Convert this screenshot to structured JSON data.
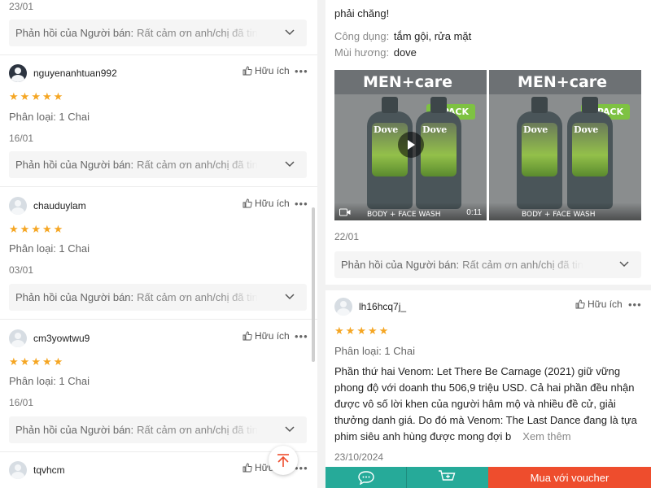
{
  "left": {
    "top_date": "23/01",
    "seller_reply_label": "Phản hồi của Người bán:",
    "seller_reply_text": "Rất cảm ơn anh/chị đã tin",
    "helpful_label": "Hữu ích",
    "more_label": "•••",
    "reviews": [
      {
        "username": "nguyenanhtuan992",
        "variant": "Phân loại: 1 Chai",
        "date": "16/01",
        "rating": 5
      },
      {
        "username": "chauduylam",
        "variant": "Phân loại: 1 Chai",
        "date": "03/01",
        "rating": 5
      },
      {
        "username": "cm3yowtwu9",
        "variant": "Phân loại: 1 Chai",
        "date": "16/01",
        "rating": 5
      },
      {
        "username": "tqvhcm",
        "helpful_partial": "Hữu"
      }
    ]
  },
  "right": {
    "top_text": "phải chăng!",
    "usage_key": "Công dụng:",
    "usage_val": "tắm gội, rửa mặt",
    "scent_key": "Mùi hương:",
    "scent_val": "dove",
    "media": {
      "brand": "MEN+care",
      "pack": "2 PACK",
      "bottle_label": "Dove",
      "wash_label": "BODY + FACE WASH",
      "duration": "0:11"
    },
    "date1": "22/01",
    "seller_reply_label": "Phản hồi của Người bán:",
    "seller_reply_text": "Rất cảm ơn anh/chị đã tin",
    "review2": {
      "username": "lh16hcq7j_",
      "helpful": "Hữu ích",
      "variant": "Phân loại: 1 Chai",
      "body": "Phần thứ hai Venom: Let There Be Carnage (2021) giữ vững phong độ với doanh thu 506,9 triệu USD. Cả hai phần đều nhận được vô số lời khen của người hâm mộ và nhiều đề cử, giải thưởng danh giá. Do đó mà Venom: The Last Dance đang là tựa phim siêu anh hùng được mong đợi b",
      "see_more": "Xem thêm",
      "date": "23/10/2024"
    },
    "buy_label": "Mua với voucher"
  },
  "colors": {
    "star": "#f5a623",
    "teal": "#26aa99",
    "orange": "#ee4d2d"
  }
}
